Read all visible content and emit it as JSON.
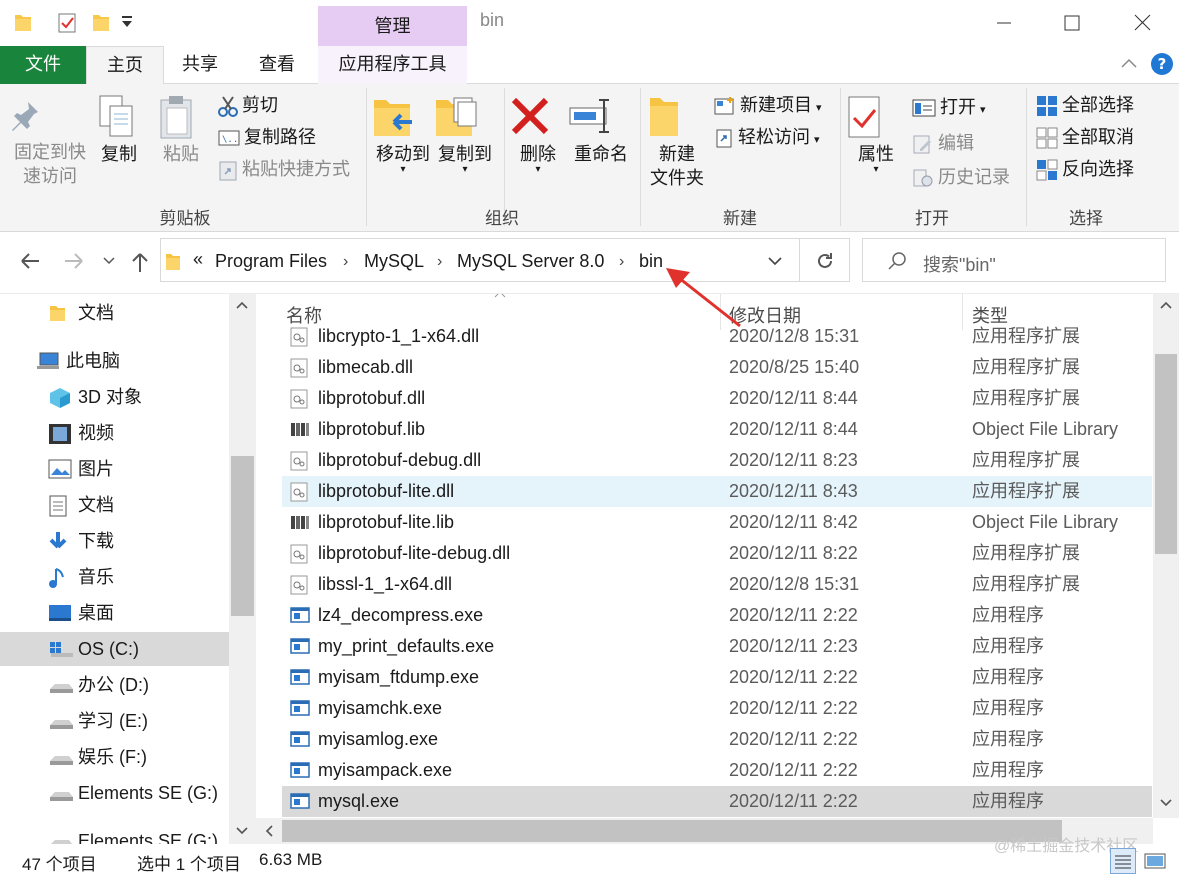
{
  "window": {
    "title": "bin",
    "manage_tab": "管理"
  },
  "ribbon_tabs": {
    "file": "文件",
    "home": "主页",
    "share": "共享",
    "view": "查看",
    "app_tools": "应用程序工具"
  },
  "ribbon": {
    "clipboard": {
      "pin_line1": "固定到快",
      "pin_line2": "速访问",
      "copy": "复制",
      "paste": "粘贴",
      "cut": "剪切",
      "copy_path": "复制路径",
      "paste_shortcut": "粘贴快捷方式",
      "label": "剪贴板"
    },
    "organize": {
      "move_to": "移动到",
      "copy_to": "复制到",
      "delete": "删除",
      "rename": "重命名",
      "label": "组织"
    },
    "new": {
      "new_folder_line1": "新建",
      "new_folder_line2": "文件夹",
      "new_item": "新建项目",
      "easy_access": "轻松访问",
      "label": "新建"
    },
    "open": {
      "properties": "属性",
      "open": "打开",
      "edit": "编辑",
      "history": "历史记录",
      "label": "打开"
    },
    "select": {
      "select_all": "全部选择",
      "select_none": "全部取消",
      "invert": "反向选择",
      "label": "选择"
    }
  },
  "address": {
    "overflow": "«",
    "crumbs": [
      "Program Files",
      "MySQL",
      "MySQL Server 8.0",
      "bin"
    ],
    "search_placeholder": "搜索\"bin\""
  },
  "nav": {
    "items": [
      {
        "label": "文档",
        "icon": "folder-icon"
      },
      {
        "label": "此电脑",
        "icon": "computer-icon"
      },
      {
        "label": "3D 对象",
        "icon": "3d-objects-icon"
      },
      {
        "label": "视频",
        "icon": "video-icon"
      },
      {
        "label": "图片",
        "icon": "pictures-icon"
      },
      {
        "label": "文档",
        "icon": "documents-icon"
      },
      {
        "label": "下载",
        "icon": "download-icon"
      },
      {
        "label": "音乐",
        "icon": "music-icon"
      },
      {
        "label": "桌面",
        "icon": "desktop-icon"
      },
      {
        "label": "OS (C:)",
        "icon": "os-drive-icon"
      },
      {
        "label": "办公 (D:)",
        "icon": "drive-icon"
      },
      {
        "label": "学习 (E:)",
        "icon": "drive-icon"
      },
      {
        "label": "娱乐 (F:)",
        "icon": "drive-icon"
      },
      {
        "label": "Elements SE (G:)",
        "icon": "drive-icon"
      },
      {
        "label": "Elements SE (G:)",
        "icon": "drive-icon"
      }
    ]
  },
  "columns": {
    "name": "名称",
    "date": "修改日期",
    "type": "类型"
  },
  "files": [
    {
      "name": "libcrypto-1_1-x64.dll",
      "date": "2020/12/8 15:31",
      "type": "应用程序扩展",
      "kind": "dll"
    },
    {
      "name": "libmecab.dll",
      "date": "2020/8/25 15:40",
      "type": "应用程序扩展",
      "kind": "dll"
    },
    {
      "name": "libprotobuf.dll",
      "date": "2020/12/11 8:44",
      "type": "应用程序扩展",
      "kind": "dll"
    },
    {
      "name": "libprotobuf.lib",
      "date": "2020/12/11 8:44",
      "type": "Object File Library",
      "kind": "lib"
    },
    {
      "name": "libprotobuf-debug.dll",
      "date": "2020/12/11 8:23",
      "type": "应用程序扩展",
      "kind": "dll"
    },
    {
      "name": "libprotobuf-lite.dll",
      "date": "2020/12/11 8:43",
      "type": "应用程序扩展",
      "kind": "dll"
    },
    {
      "name": "libprotobuf-lite.lib",
      "date": "2020/12/11 8:42",
      "type": "Object File Library",
      "kind": "lib"
    },
    {
      "name": "libprotobuf-lite-debug.dll",
      "date": "2020/12/11 8:22",
      "type": "应用程序扩展",
      "kind": "dll"
    },
    {
      "name": "libssl-1_1-x64.dll",
      "date": "2020/12/8 15:31",
      "type": "应用程序扩展",
      "kind": "dll"
    },
    {
      "name": "lz4_decompress.exe",
      "date": "2020/12/11 2:22",
      "type": "应用程序",
      "kind": "exe"
    },
    {
      "name": "my_print_defaults.exe",
      "date": "2020/12/11 2:23",
      "type": "应用程序",
      "kind": "exe"
    },
    {
      "name": "myisam_ftdump.exe",
      "date": "2020/12/11 2:22",
      "type": "应用程序",
      "kind": "exe"
    },
    {
      "name": "myisamchk.exe",
      "date": "2020/12/11 2:22",
      "type": "应用程序",
      "kind": "exe"
    },
    {
      "name": "myisamlog.exe",
      "date": "2020/12/11 2:22",
      "type": "应用程序",
      "kind": "exe"
    },
    {
      "name": "myisampack.exe",
      "date": "2020/12/11 2:22",
      "type": "应用程序",
      "kind": "exe"
    },
    {
      "name": "mysql.exe",
      "date": "2020/12/11 2:22",
      "type": "应用程序",
      "kind": "exe"
    }
  ],
  "status": {
    "count": "47 个项目",
    "selected": "选中 1 个项目",
    "size": "6.63 MB",
    "watermark": "@稀土掘金技术社区"
  },
  "colors": {
    "file_tab": "#19843b",
    "manage_tab": "#e6ccf2",
    "hover_row": "#e5f3fb",
    "selected_row": "#d9d9d9",
    "annotation_arrow": "#e0312d"
  }
}
